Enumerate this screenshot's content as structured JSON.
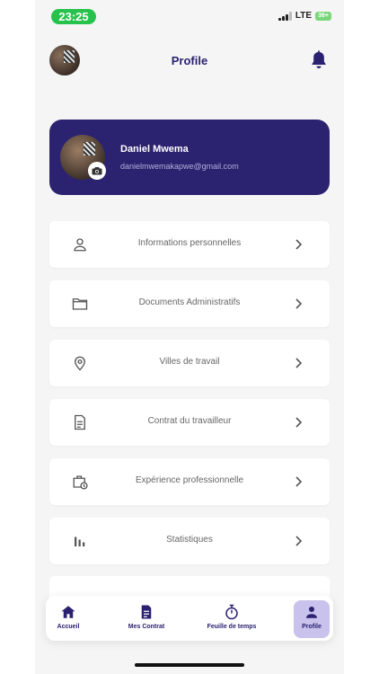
{
  "status_bar": {
    "time": "23:25",
    "network": "LTE",
    "battery": "36+"
  },
  "header": {
    "title": "Profile"
  },
  "profile": {
    "name": "Daniel Mwema",
    "email": "danielmwemakapwe@gmail.com"
  },
  "menu": [
    {
      "label": "Informations personnelles",
      "icon": "user-icon"
    },
    {
      "label": "Documents Administratifs",
      "icon": "folder-icon"
    },
    {
      "label": "Villes de travail",
      "icon": "location-pin-icon"
    },
    {
      "label": "Contrat du travailleur",
      "icon": "document-icon"
    },
    {
      "label": "Expérience professionnelle",
      "icon": "briefcase-clock-icon"
    },
    {
      "label": "Statistiques",
      "icon": "bar-chart-icon"
    }
  ],
  "bottom_nav": [
    {
      "label": "Accueil",
      "icon": "home-icon",
      "active": false
    },
    {
      "label": "Mes Contrat",
      "icon": "file-icon",
      "active": false
    },
    {
      "label": "Feuille de temps",
      "icon": "stopwatch-icon",
      "active": false
    },
    {
      "label": "Profile",
      "icon": "profile-icon",
      "active": true
    }
  ],
  "colors": {
    "primary": "#2b2370",
    "active_tab_bg": "#c8c2ec",
    "time_pill": "#27c24c",
    "background": "#f5f5f6"
  }
}
